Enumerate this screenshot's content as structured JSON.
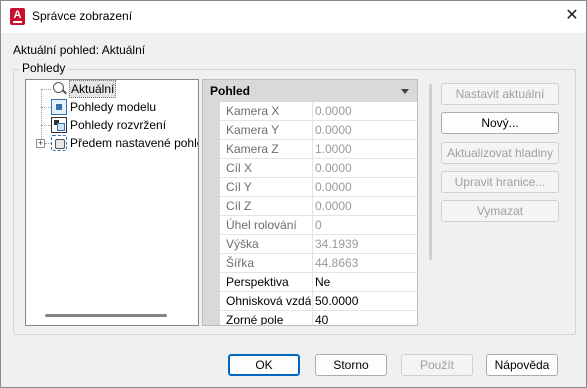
{
  "window": {
    "title": "Správce zobrazení",
    "close_glyph": "✕",
    "app_icon": "autocad-app-icon"
  },
  "current_view": {
    "label": "Aktuální pohled: Aktuální"
  },
  "views_group": {
    "legend": "Pohledy"
  },
  "tree": {
    "items": [
      {
        "label": "Aktuální",
        "icon": "camera-icon",
        "selected": true
      },
      {
        "label": "Pohledy modelu",
        "icon": "model-views-icon"
      },
      {
        "label": "Pohledy rozvržení",
        "icon": "layout-views-icon"
      },
      {
        "label": "Předem nastavené pohledy",
        "icon": "preset-views-icon",
        "expander": "+"
      }
    ]
  },
  "properties": {
    "header": "Pohled",
    "rows": [
      {
        "label": "Kamera X",
        "value": "0.0000",
        "disabled": true
      },
      {
        "label": "Kamera Y",
        "value": "0.0000",
        "disabled": true
      },
      {
        "label": "Kamera Z",
        "value": "1.0000",
        "disabled": true
      },
      {
        "label": "Cíl X",
        "value": "0.0000",
        "disabled": true
      },
      {
        "label": "Cíl Y",
        "value": "0.0000",
        "disabled": true
      },
      {
        "label": "Cíl Z",
        "value": "0.0000",
        "disabled": true
      },
      {
        "label": "Úhel rolování",
        "value": "0",
        "disabled": true
      },
      {
        "label": "Výška",
        "value": "34.1939",
        "disabled": true
      },
      {
        "label": "Šířka",
        "value": "44.8663",
        "disabled": true
      },
      {
        "label": "Perspektiva",
        "value": "Ne",
        "disabled": false
      },
      {
        "label": "Ohnisková vzdálenost",
        "value": "50.0000",
        "disabled": false
      },
      {
        "label": "Zorné pole",
        "value": "40",
        "disabled": false
      }
    ]
  },
  "side_buttons": {
    "set_current": "Nastavit aktuální",
    "new": "Nový...",
    "update_layers": "Aktualizovat hladiny",
    "edit_boundaries": "Upravit hranice...",
    "delete": "Vymazat"
  },
  "footer_buttons": {
    "ok": "OK",
    "cancel": "Storno",
    "apply": "Použít",
    "help": "Nápověda"
  }
}
